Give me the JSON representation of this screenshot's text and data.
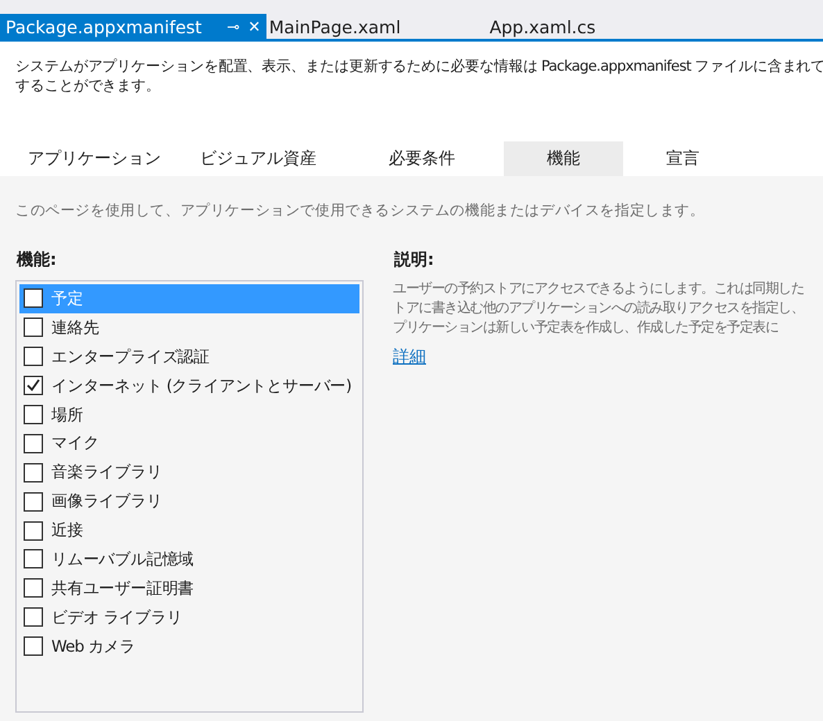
{
  "document_tabs": [
    {
      "label": "Package.appxmanifest",
      "selected": true,
      "pin": "⊸",
      "close": "✕"
    },
    {
      "label": "MainPage.xaml",
      "selected": false
    },
    {
      "label": "App.xaml.cs",
      "selected": false
    }
  ],
  "intro": [
    "システムがアプリケーションを配置、表示、または更新するために必要な情報は Package.appxmanifest ファイルに含まれて",
    "することができます。"
  ],
  "tabs": [
    {
      "label": "アプリケーション",
      "selected": false
    },
    {
      "label": "ビジュアル資産",
      "selected": false
    },
    {
      "label": "必要条件",
      "selected": false
    },
    {
      "label": "機能",
      "selected": true
    },
    {
      "label": "宣言",
      "selected": false
    }
  ],
  "page_hint": "このページを使用して、アプリケーションで使用できるシステムの機能またはデバイスを指定します。",
  "capabilities": {
    "heading": "機能:",
    "items": [
      {
        "label": "予定",
        "checked": false,
        "selected": true
      },
      {
        "label": "連絡先",
        "checked": false,
        "selected": false
      },
      {
        "label": "エンタープライズ認証",
        "checked": false,
        "selected": false
      },
      {
        "label": "インターネット (クライアントとサーバー)",
        "checked": true,
        "selected": false
      },
      {
        "label": "場所",
        "checked": false,
        "selected": false
      },
      {
        "label": "マイク",
        "checked": false,
        "selected": false
      },
      {
        "label": "音楽ライブラリ",
        "checked": false,
        "selected": false
      },
      {
        "label": "画像ライブラリ",
        "checked": false,
        "selected": false
      },
      {
        "label": "近接",
        "checked": false,
        "selected": false
      },
      {
        "label": "リムーバブル記憶域",
        "checked": false,
        "selected": false
      },
      {
        "label": "共有ユーザー証明書",
        "checked": false,
        "selected": false
      },
      {
        "label": "ビデオ ライブラリ",
        "checked": false,
        "selected": false
      },
      {
        "label": "Web カメラ",
        "checked": false,
        "selected": false
      }
    ]
  },
  "description": {
    "heading": "説明:",
    "lines": [
      "ユーザーの予約ストアにアクセスできるようにします。これは同期した",
      "トアに書き込む他のアプリケーションへの読み取りアクセスを指定し、",
      "プリケーションは新しい予定表を作成し、作成した予定を予定表に"
    ],
    "link": "詳細"
  }
}
